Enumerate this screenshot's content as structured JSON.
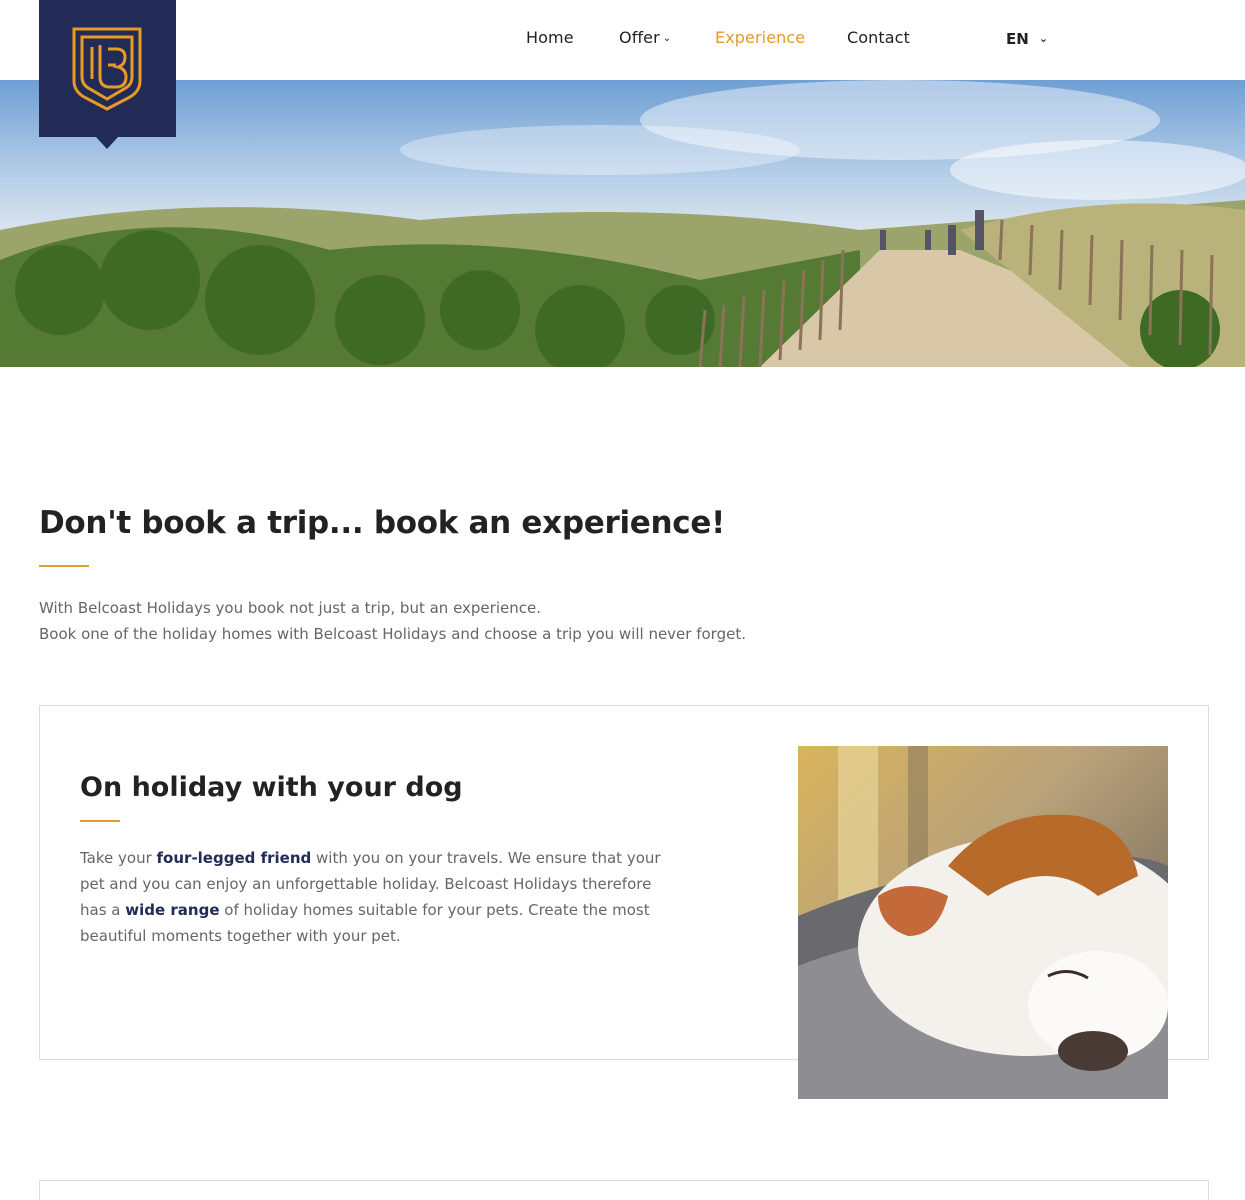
{
  "nav": {
    "items": [
      {
        "label": "Home"
      },
      {
        "label": "Offer"
      },
      {
        "label": "Experience"
      },
      {
        "label": "Contact"
      }
    ],
    "language": "EN"
  },
  "colors": {
    "brand_navy": "#222b55",
    "accent_orange": "#e69a28"
  },
  "intro": {
    "title": "Don't book a trip... book an experience!",
    "paragraph_line1": "With Belcoast Holidays you book not just a trip, but an experience.",
    "paragraph_line2": "Book one of the holiday homes with Belcoast Holidays and choose a trip you will never forget."
  },
  "dog_card": {
    "title": "On holiday with your dog",
    "text_1": "Take your ",
    "bold_1": "four-legged friend",
    "text_2": " with you on your travels. We ensure that your pet and you can enjoy an unforgettable holiday. Belcoast Holidays therefore has a ",
    "bold_2": "wide range",
    "text_3": " of holiday homes suitable for your pets. Create the most beautiful moments together with your pet."
  }
}
